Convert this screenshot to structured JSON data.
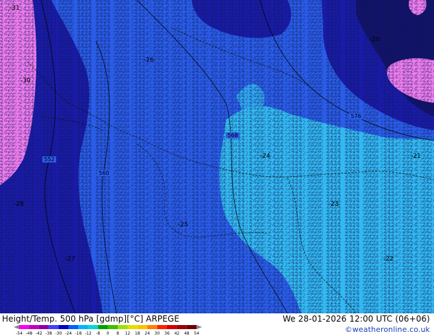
{
  "header": {
    "title": "Height/Temp. 500 hPa [gdmp][°C] ARPEGE",
    "datetime": "We 28-01-2026 12:00 UTC (06+06)",
    "credit": "©weatheronline.co.uk"
  },
  "legend": {
    "tick_labels": [
      "-54",
      "-48",
      "-42",
      "-38",
      "-30",
      "-24",
      "-18",
      "-12",
      "-8",
      "0",
      "8",
      "12",
      "18",
      "24",
      "30",
      "36",
      "42",
      "48",
      "54"
    ],
    "colors": [
      "#f400f4",
      "#c000c0",
      "#8a00a8",
      "#4040ff",
      "#0000c8",
      "#0060ff",
      "#00b4ff",
      "#00d8d8",
      "#00a000",
      "#40c000",
      "#a0e000",
      "#e0e000",
      "#ffc000",
      "#ff8000",
      "#ff2000",
      "#d00000",
      "#a00000",
      "#700000"
    ]
  },
  "map_colors": {
    "pink": "#ee7cee",
    "navy": "#1a1aa8",
    "blue": "#2a5ce8",
    "light_blue": "#33b8f2",
    "dark": "#12126a"
  },
  "contour_labels": [
    "552",
    "560",
    "568",
    "576"
  ],
  "temperature_values": [
    "-31",
    "-30",
    "-28",
    "-27",
    "-26",
    "-25",
    "-24",
    "-23",
    "-22",
    "-21",
    "-20"
  ]
}
